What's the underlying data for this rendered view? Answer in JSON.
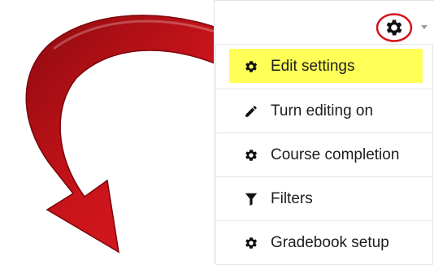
{
  "menu": {
    "items": [
      {
        "label": "Edit settings",
        "icon": "gear-icon",
        "highlighted": true
      },
      {
        "label": "Turn editing on",
        "icon": "pencil-icon"
      },
      {
        "label": "Course completion",
        "icon": "gear-icon"
      },
      {
        "label": "Filters",
        "icon": "filter-icon"
      },
      {
        "label": "Gradebook setup",
        "icon": "gear-icon"
      }
    ]
  },
  "colors": {
    "highlight": "#ffff58",
    "annotation_red": "#c8141a",
    "text": "#1d1d1d"
  }
}
